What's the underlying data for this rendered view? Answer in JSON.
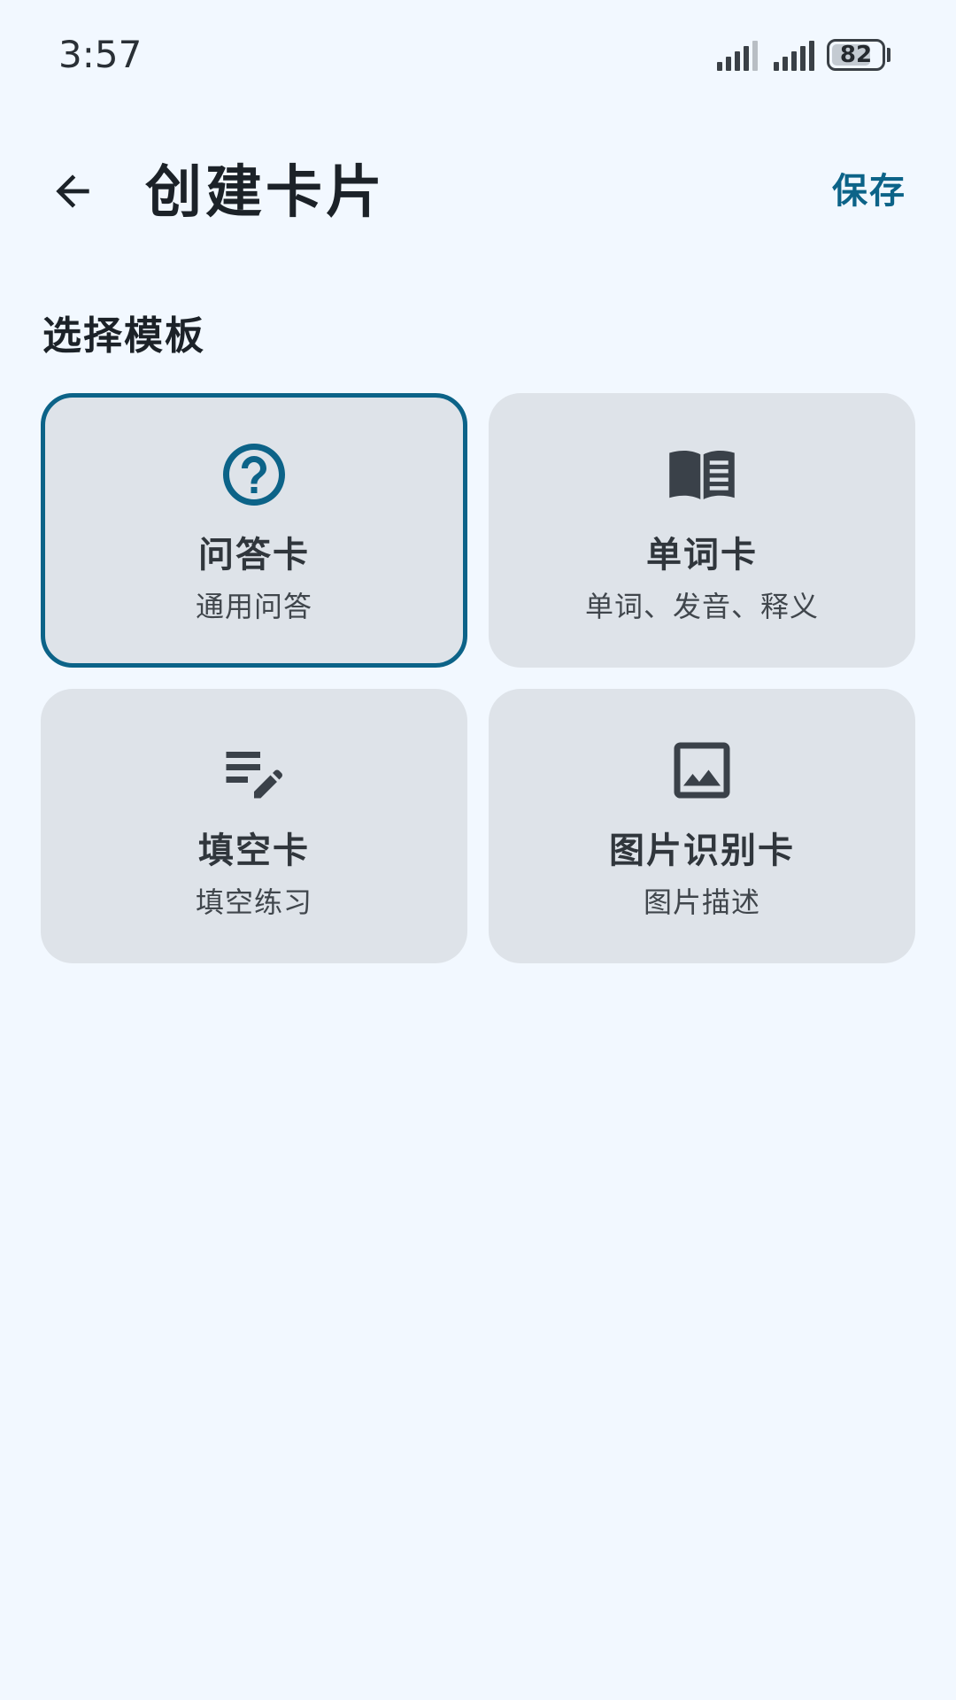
{
  "status_bar": {
    "time": "3:57",
    "battery_level": "82",
    "battery_percent": 0.82
  },
  "app_bar": {
    "back_icon": "arrow-back-icon",
    "title": "创建卡片",
    "save_label": "保存"
  },
  "section": {
    "title": "选择模板"
  },
  "templates": [
    {
      "title": "问答卡",
      "subtitle": "通用问答",
      "icon": "help-circle-icon",
      "selected": true
    },
    {
      "title": "单词卡",
      "subtitle": "单词、发音、释义",
      "icon": "open-book-icon",
      "selected": false
    },
    {
      "title": "填空卡",
      "subtitle": "填空练习",
      "icon": "edit-note-icon",
      "selected": false
    },
    {
      "title": "图片识别卡",
      "subtitle": "图片描述",
      "icon": "image-icon",
      "selected": false
    }
  ],
  "colors": {
    "background": "#F2F8FF",
    "accent": "#0C6388",
    "card_background": "#DEE3E9",
    "icon_dark": "#3A4149"
  }
}
